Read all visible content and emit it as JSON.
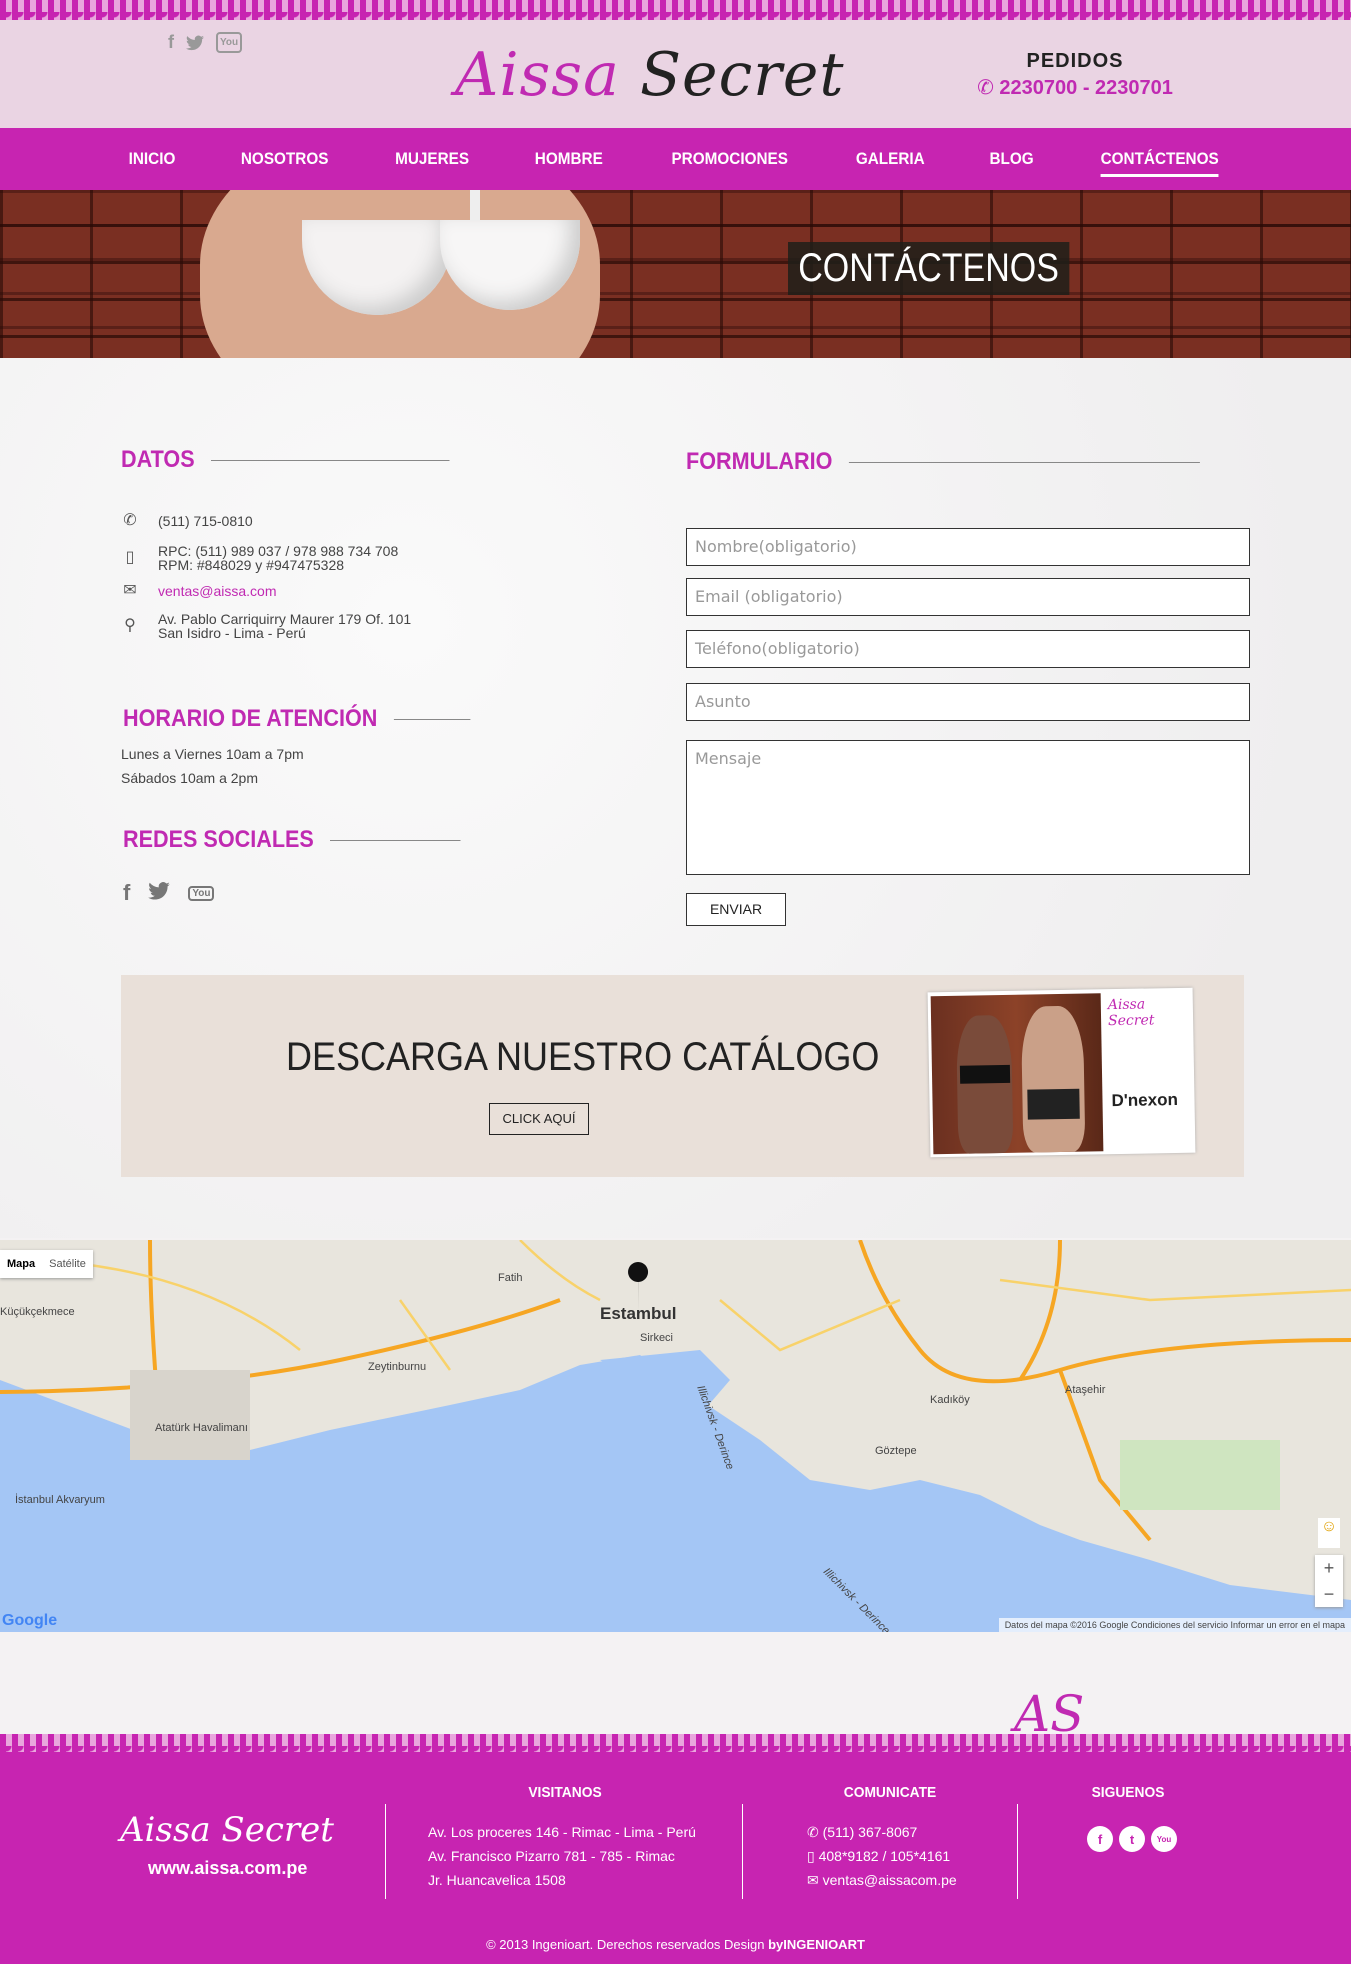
{
  "header": {
    "logo_part1": "Aissa",
    "logo_part2": "Secret",
    "pedidos_title": "PEDIDOS",
    "pedidos_phones": "2230700 -  2230701"
  },
  "nav": {
    "items": [
      "INICIO",
      "NOSOTROS",
      "MUJERES",
      "HOMBRE",
      "PROMOCIONES",
      "GALERIA",
      "BLOG",
      "CONTÁCTENOS"
    ],
    "active": "CONTÁCTENOS"
  },
  "hero": {
    "title": "CONTÁCTENOS"
  },
  "datos": {
    "title": "DATOS",
    "phone": "(511) 715-0810",
    "rpc": "RPC: (511) 989 037 / 978 988 734 708",
    "rpm": "RPM: #848029 y #947475328",
    "email": "ventas@aissa.com",
    "address1": "Av. Pablo Carriquirry Maurer 179 Of. 101",
    "address2": "San Isidro - Lima - Perú"
  },
  "horario": {
    "title": "HORARIO DE ATENCIÓN",
    "line1": "Lunes a Viernes 10am a 7pm",
    "line2": "Sábados 10am a 2pm"
  },
  "redes": {
    "title": "REDES SOCIALES"
  },
  "form": {
    "title": "FORMULARIO",
    "name_placeholder": "Nombre(obligatorio)",
    "email_placeholder": "Email (obligatorio)",
    "phone_placeholder": "Teléfono(obligatorio)",
    "subject_placeholder": "Asunto",
    "message_placeholder": "Mensaje",
    "submit": "ENVIAR"
  },
  "catalog": {
    "title": "DESCARGA NUESTRO CATÁLOGO",
    "button": "CLICK AQUÍ",
    "cover_brand": "Aissa Secret",
    "cover_dnexon": "D'nexon"
  },
  "map": {
    "type_map": "Mapa",
    "type_satellite": "Satélite",
    "labels": [
      "Fatih",
      "Estambul",
      "Sirkeci",
      "Küçükçekmece",
      "Zeytinburnu",
      "Atatürk Havalimanı",
      "İstanbul Akvaryum",
      "Kadıköy",
      "Ataşehir",
      "Göztepe",
      "Illichivsk - Derince",
      "Illichivsk - Derince"
    ],
    "zoom_in": "+",
    "zoom_out": "−",
    "attribution": "Datos del mapa ©2016 Google   Condiciones del servicio   Informar un error en el mapa",
    "google": "Google"
  },
  "footer": {
    "logo": "Aissa Secret",
    "url": "www.aissa.com.pe",
    "visitanos_title": "VISITANOS",
    "visitanos": [
      "Av. Los proceres 146 - Rimac - Lima - Perú",
      "Av. Francisco Pizarro 781 - 785 - Rimac",
      "Jr. Huancavelica 1508"
    ],
    "comunicate_title": "COMUNICATE",
    "comunicate_phone": "(511) 367-8067",
    "comunicate_mobile": "408*9182 / 105*4161",
    "comunicate_email": "ventas@aissacom.pe",
    "siguenos_title": "SIGUENOS",
    "copyright": "© 2013 Ingenioart. Derechos reservados Design ",
    "copyright_bold": "byINGENIOART"
  },
  "colors": {
    "accent": "#c724b1",
    "header_bg": "#ead4e3",
    "catalog_bg": "#e9e0d9"
  }
}
